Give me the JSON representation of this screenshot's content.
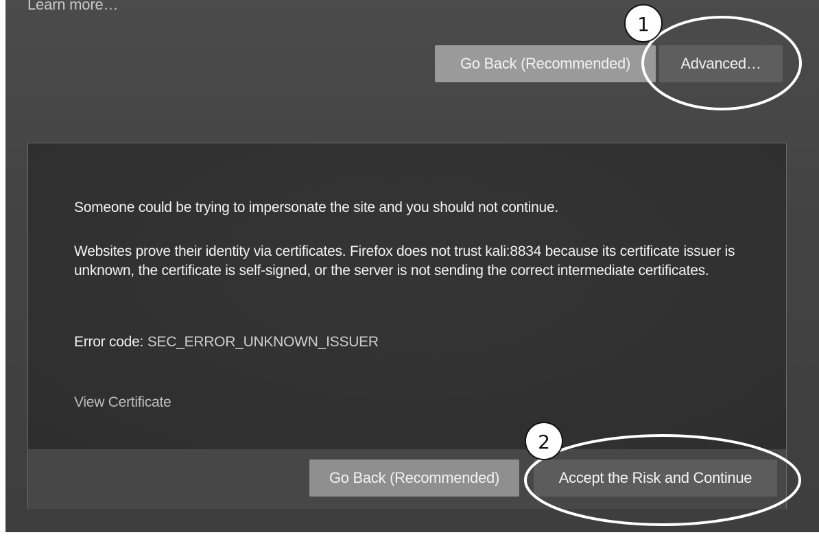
{
  "page": {
    "learn_more": "Learn more…",
    "top_buttons": {
      "go_back": "Go Back (Recommended)",
      "advanced": "Advanced…"
    },
    "advanced_panel": {
      "warning": "Someone could be trying to impersonate the site and you should not continue.",
      "explanation": "Websites prove their identity via certificates. Firefox does not trust kali:8834 because its certificate issuer is unknown, the certificate is self-signed, or the server is not sending the correct intermediate certificates.",
      "error_code_label": "Error code:",
      "error_code_value": "SEC_ERROR_UNKNOWN_ISSUER",
      "view_certificate": "View Certificate",
      "go_back": "Go Back (Recommended)",
      "accept": "Accept the Risk and Continue"
    }
  },
  "annotations": [
    {
      "number": "1",
      "target": "Advanced…"
    },
    {
      "number": "2",
      "target": "Accept the Risk and Continue"
    }
  ],
  "colors": {
    "page_background": "#444444",
    "panel_background": "#303030",
    "panel_footer": "#474747",
    "primary_button": "#9a9a9a",
    "secondary_button": "#5e5e5e",
    "annotation_stroke": "#ffffff"
  }
}
